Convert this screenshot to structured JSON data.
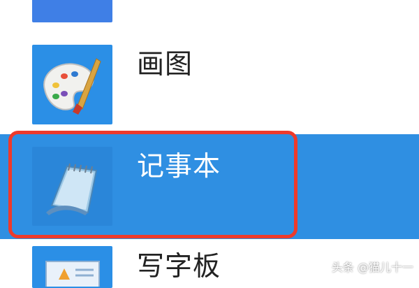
{
  "start_menu": {
    "items": [
      {
        "label": "画图",
        "icon": "paint-palette-icon"
      },
      {
        "label": "记事本",
        "icon": "notepad-icon",
        "selected": true
      },
      {
        "label": "写字板",
        "icon": "wordpad-icon"
      }
    ]
  },
  "watermark": "头条 @猫儿十一",
  "colors": {
    "tile_blue": "#2b8fe6",
    "selection_blue": "#2f8fe2",
    "highlight_outline": "#ee3a2b"
  }
}
